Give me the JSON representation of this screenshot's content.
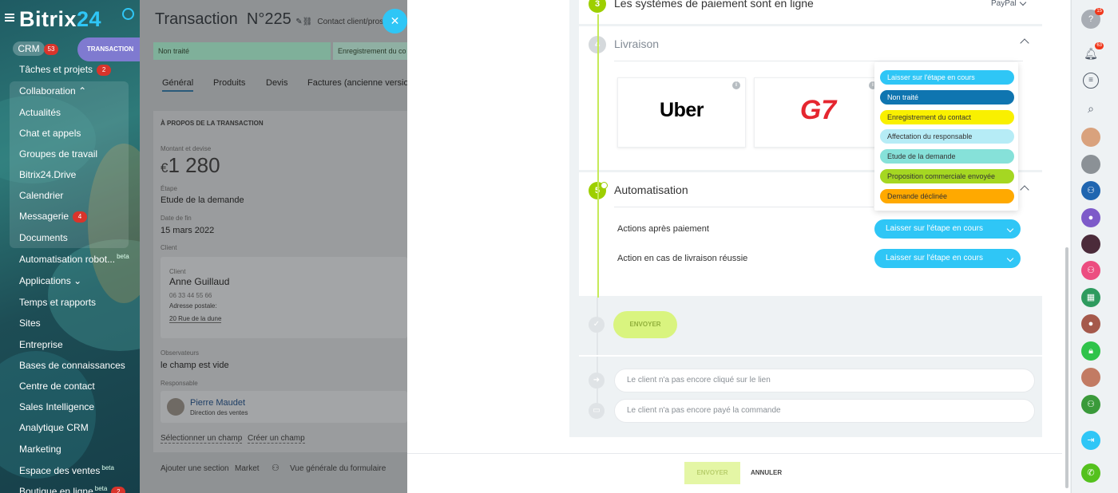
{
  "sidebar": {
    "logo_text": "Bitrix",
    "logo_num": "24",
    "crm_label": "CRM",
    "crm_count": "53",
    "transaction_label": "TRANSACTION",
    "items": [
      {
        "label": "Tâches et projets",
        "badge": "2"
      },
      {
        "label": "Collaboration"
      },
      {
        "label": "Actualités"
      },
      {
        "label": "Chat et appels"
      },
      {
        "label": "Groupes de travail"
      },
      {
        "label": "Bitrix24.Drive"
      },
      {
        "label": "Calendrier"
      },
      {
        "label": "Messagerie",
        "badge": "4"
      },
      {
        "label": "Documents"
      },
      {
        "label": "Automatisation robot...",
        "beta": "beta"
      },
      {
        "label": "Applications"
      },
      {
        "label": "Temps et rapports"
      },
      {
        "label": "Sites"
      },
      {
        "label": "Entreprise"
      },
      {
        "label": "Bases de connaissances"
      },
      {
        "label": "Centre de contact"
      },
      {
        "label": "Sales Intelligence"
      },
      {
        "label": "Analytique CRM"
      },
      {
        "label": "Marketing"
      },
      {
        "label": "Espace des ventes",
        "beta": "beta"
      },
      {
        "label": "Boutique en ligne",
        "beta": "beta",
        "badge": "2"
      }
    ]
  },
  "deal": {
    "title": "Transaction",
    "number": "N°225",
    "contact_link": "Contact client/prospec",
    "stages": [
      "Non traité",
      "Enregistrement du co"
    ],
    "tabs": [
      "Général",
      "Produits",
      "Devis",
      "Factures (ancienne version"
    ],
    "section_title": "À PROPOS DE LA TRANSACTION",
    "amount_label": "Montant et devise",
    "currency": "€",
    "amount": "1 280",
    "stage_label": "Étape",
    "stage_value": "Etude de la demande",
    "end_date_label": "Date de fin",
    "end_date": "15 mars 2022",
    "client_label": "Client",
    "client_sublabel": "Client",
    "client_name": "Anne Guillaud",
    "client_phone": "06 33 44 55 66",
    "client_address_label": "Adresse postale:",
    "client_address": "20 Rue de la dune",
    "observers_label": "Observateurs",
    "observers_value": "le champ est vide",
    "responsible_label": "Responsable",
    "responsible_name": "Pierre Maudet",
    "responsible_role": "Direction des ventes",
    "select_field": "Sélectionner un champ",
    "create_field": "Créer un champ",
    "add_section": "Ajouter une section",
    "market": "Market",
    "form_overview": "Vue générale du formulaire"
  },
  "panel": {
    "step3_num": "3",
    "step3_title": "Les systèmes de paiement sont en ligne",
    "step3_value": "PayPal",
    "step4_num": "4",
    "step4_title": "Livraison",
    "delivery_logos": [
      "Uber",
      "G7"
    ],
    "step5_num": "5",
    "step5_title": "Automatisation",
    "dropdown_options": [
      {
        "label": "Laisser sur l'étape en cours",
        "bg": "#2fc6f6",
        "fg": "#ffffff"
      },
      {
        "label": "Non traité",
        "bg": "#0f75b0",
        "fg": "#ffffff"
      },
      {
        "label": "Enregistrement du contact",
        "bg": "#f9f000",
        "fg": "#333333"
      },
      {
        "label": "Affectation du responsable",
        "bg": "#b6ecf6",
        "fg": "#333333"
      },
      {
        "label": "Etude de la demande",
        "bg": "#86e1d9",
        "fg": "#333333"
      },
      {
        "label": "Proposition commerciale envoyée",
        "bg": "#a5d722",
        "fg": "#333333"
      },
      {
        "label": "Demande déclinée",
        "bg": "#ffa900",
        "fg": "#333333"
      }
    ],
    "automation_rows": [
      {
        "label": "Actions après paiement",
        "value": "Laisser sur l'étape en cours"
      },
      {
        "label": "Action en cas de livraison réussie",
        "value": "Laisser sur l'étape en cours"
      }
    ],
    "send_label": "ENVOYER",
    "status_lines": [
      "Le client n'a pas encore cliqué sur le lien",
      "Le client n'a pas encore payé la commande"
    ],
    "footer_send": "ENVOYER",
    "footer_cancel": "ANNULER"
  },
  "right_bar": {
    "help_badge": "15",
    "notif_badge": "63",
    "help_icon": "?"
  }
}
